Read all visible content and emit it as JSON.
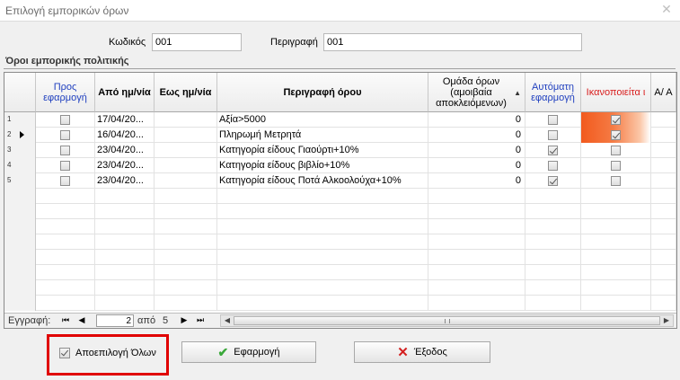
{
  "window": {
    "title": "Επιλογή εμπορικών όρων"
  },
  "form": {
    "code_label": "Κωδικός",
    "code_value": "001",
    "description_label": "Περιγραφή",
    "description_value": "001"
  },
  "section": {
    "title": "Όροι εμπορικής πολιτικής"
  },
  "grid": {
    "columns": {
      "apply": "Προς εφαρμογή",
      "from": "Από ημ/νία",
      "to": "Εως ημ/νία",
      "description": "Περιγραφή όρου",
      "group": "Ομάδα όρων (αμοιβαία αποκλειόμενων)",
      "auto": "Αυτόματη εφαρμογή",
      "satisfied": "Ικανοποιείτα ι",
      "aa": "Α/ Α"
    },
    "rows": [
      {
        "num": "1",
        "apply": false,
        "from": "17/04/20...",
        "to": "",
        "description": "Αξία>5000",
        "group": "0",
        "auto": false,
        "satisfied": true,
        "highlight": true,
        "current": false
      },
      {
        "num": "2",
        "apply": false,
        "from": "16/04/20...",
        "to": "",
        "description": "Πληρωμή Μετρητά",
        "group": "0",
        "auto": false,
        "satisfied": true,
        "highlight": true,
        "current": true
      },
      {
        "num": "3",
        "apply": false,
        "from": "23/04/20...",
        "to": "",
        "description": "Κατηγορία είδους Γιαούρτι+10%",
        "group": "0",
        "auto": true,
        "satisfied": false,
        "highlight": false,
        "current": false
      },
      {
        "num": "4",
        "apply": false,
        "from": "23/04/20...",
        "to": "",
        "description": "Κατηγορία είδους βιβλίο+10%",
        "group": "0",
        "auto": false,
        "satisfied": false,
        "highlight": false,
        "current": false
      },
      {
        "num": "5",
        "apply": false,
        "from": "23/04/20...",
        "to": "",
        "description": "Κατηγορία είδους Ποτά Αλκοολούχα+10%",
        "group": "0",
        "auto": true,
        "satisfied": false,
        "highlight": false,
        "current": false
      }
    ],
    "navigator": {
      "record_label": "Εγγραφή:",
      "current": "2",
      "of_label": "από",
      "total": "5"
    }
  },
  "buttons": {
    "deselect_all": "Αποεπιλογή Όλων",
    "apply": "Εφαρμογή",
    "exit": "Έξοδος"
  },
  "colors": {
    "highlight": "#e00000",
    "satisfied_fill": "#f25a1e",
    "header_blue": "#1f3fbf",
    "header_red": "#d81c1c",
    "apply_icon": "#3aa83a",
    "exit_icon": "#d42020"
  }
}
